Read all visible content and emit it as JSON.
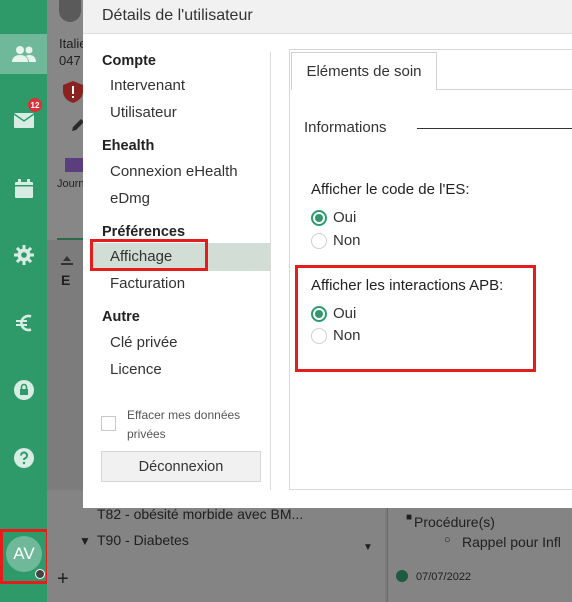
{
  "sidebar": {
    "messages_badge": "12",
    "avatar_initials": "AV",
    "add_label": "+"
  },
  "background": {
    "patient_name_fragment": "Italie",
    "patient_phone_fragment": "047",
    "journal_fragment": "Journ",
    "section_letter": "E",
    "diag_t82": "T82 - obésité morbide avec BM...",
    "diag_t90": "T90 - Diabetes",
    "procedure_label": "Procédure(s)",
    "procedure_item": "Rappel pour Infl",
    "date_fragment": "07/07/2022"
  },
  "dialog": {
    "title": "Détails de l'utilisateur",
    "nav": {
      "groups": [
        {
          "label": "Compte",
          "items": [
            "Intervenant",
            "Utilisateur"
          ]
        },
        {
          "label": "Ehealth",
          "items": [
            "Connexion eHealth",
            "eDmg"
          ]
        },
        {
          "label": "Préférences",
          "items": [
            "Affichage",
            "Facturation"
          ]
        },
        {
          "label": "Autre",
          "items": [
            "Clé privée",
            "Licence"
          ]
        }
      ],
      "selected": "Affichage",
      "clear_data_label": "Effacer mes données privées",
      "logout_label": "Déconnexion"
    },
    "tab_label": "Eléments de soin",
    "section_title": "Informations",
    "questions": [
      {
        "label": "Afficher le code de l'ES:",
        "options": [
          "Oui",
          "Non"
        ],
        "selected": "Oui"
      },
      {
        "label": "Afficher les interactions APB:",
        "options": [
          "Oui",
          "Non"
        ],
        "selected": "Oui"
      }
    ]
  },
  "colors": {
    "accent": "#2e9a6a",
    "highlight": "#e41c1c",
    "badge": "#d9323a"
  }
}
